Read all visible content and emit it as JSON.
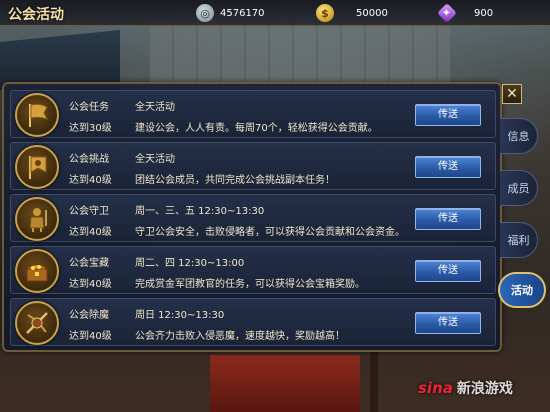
{
  "header": {
    "title": "公会活动",
    "resources": [
      {
        "icon": "silver-coin-icon",
        "value": "4576170"
      },
      {
        "icon": "gold-coin-icon",
        "value": "50000"
      },
      {
        "icon": "purple-gem-icon",
        "value": "900"
      }
    ]
  },
  "activities": [
    {
      "name": "公会任务",
      "level": "达到30级",
      "time": "全天活动",
      "desc": "建设公会，人人有责。每周70个，轻松获得公会贡献。",
      "button": "传送",
      "icon": "quest-flag-icon"
    },
    {
      "name": "公会挑战",
      "level": "达到40级",
      "time": "全天活动",
      "desc": "团结公会成员，共同完成公会挑战副本任务！",
      "button": "传送",
      "icon": "challenge-flag-icon"
    },
    {
      "name": "公会守卫",
      "level": "达到40级",
      "time": "周一、三、五 12:30~13:30",
      "desc": "守卫公会安全，击败侵略者，可以获得公会贡献和公会资金。",
      "button": "传送",
      "icon": "guardian-knight-icon"
    },
    {
      "name": "公会宝藏",
      "level": "达到40级",
      "time": "周二、四 12:30~13:00",
      "desc": "完成赏金军团教官的任务，可以获得公会宝箱奖励。",
      "button": "传送",
      "icon": "treasure-chest-icon"
    },
    {
      "name": "公会除魔",
      "level": "达到40级",
      "time": "周日 12:30~13:30",
      "desc": "公会齐力击败入侵恶魔，速度越快，奖励越高！",
      "button": "传送",
      "icon": "demon-slayer-icon"
    }
  ],
  "tabs": [
    {
      "label": "信息",
      "active": false
    },
    {
      "label": "成员",
      "active": false
    },
    {
      "label": "福利",
      "active": false
    },
    {
      "label": "活动",
      "active": true
    }
  ],
  "close_label": "✕",
  "watermark": {
    "logo": "sina",
    "text": "新浪游戏"
  },
  "colors": {
    "button": "#2a5aa8",
    "border": "#c9a24a",
    "panel": "#1a2336"
  }
}
